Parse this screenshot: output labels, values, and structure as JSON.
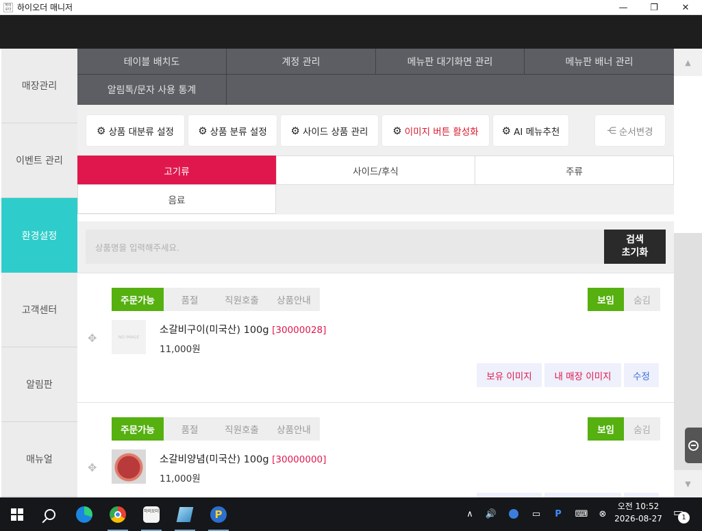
{
  "window": {
    "title": "하이오더 매니저",
    "app_icon_text": "하이오더",
    "minimize_glyph": "—",
    "maximize_glyph": "❐",
    "close_glyph": "✕"
  },
  "sidebar": {
    "items": [
      {
        "label": "매장관리",
        "active": false
      },
      {
        "label": "이벤트 관리",
        "active": false
      },
      {
        "label": "환경설정",
        "active": true
      },
      {
        "label": "고객센터",
        "active": false
      },
      {
        "label": "알림판",
        "active": false
      },
      {
        "label": "매뉴얼",
        "active": false
      }
    ]
  },
  "tabs": {
    "items": [
      "테이블 배치도",
      "계정 관리",
      "메뉴판 대기화면 관리",
      "메뉴판 배너 관리",
      "알림톡/문자 사용 통계"
    ]
  },
  "toolbar": {
    "gear_glyph": "⚙",
    "btn1": "상품 대분류 설정",
    "btn2": "상품 분류 설정",
    "btn3": "사이드 상품 관리",
    "btn4": "이미지 버튼 활성화",
    "btn5": "AI 메뉴추천",
    "reorder_glyph": "⋲",
    "reorder": "순서변경"
  },
  "categories": {
    "items": [
      "고기류",
      "사이드/후식",
      "주류",
      "음료"
    ],
    "active_index": 0
  },
  "search": {
    "placeholder": "상품명을 입력해주세요.",
    "button_line1": "검색",
    "button_line2": "초기화"
  },
  "status_options": [
    "주문가능",
    "품절",
    "직원호출",
    "상품안내"
  ],
  "visibility_options": [
    "보임",
    "숨김"
  ],
  "actions": {
    "owned_image": "보유 이미지",
    "my_store_image": "내 매장 이미지",
    "edit": "수정"
  },
  "products": [
    {
      "name": "소갈비구이(미국산) 100g",
      "code": "[30000028]",
      "price": "11,000원",
      "image": "NO IMAGE",
      "status": "주문가능",
      "visibility": "보임"
    },
    {
      "name": "소갈비양념(미국산) 100g",
      "code": "[30000000]",
      "price": "11,000원",
      "image": "",
      "status": "주문가능",
      "visibility": "보임"
    }
  ],
  "scrollbar": {
    "up_glyph": "▲",
    "down_glyph": "▼"
  },
  "taskbar": {
    "hai_icon_text": "하이오더",
    "tray_up": "∧",
    "volume": "🔊",
    "ime_p": "P",
    "keyboard": "⌨",
    "close_circle": "⊗",
    "clock_time": "오전 10:52",
    "clock_date": "2026-08-27",
    "notification_count": "1"
  }
}
